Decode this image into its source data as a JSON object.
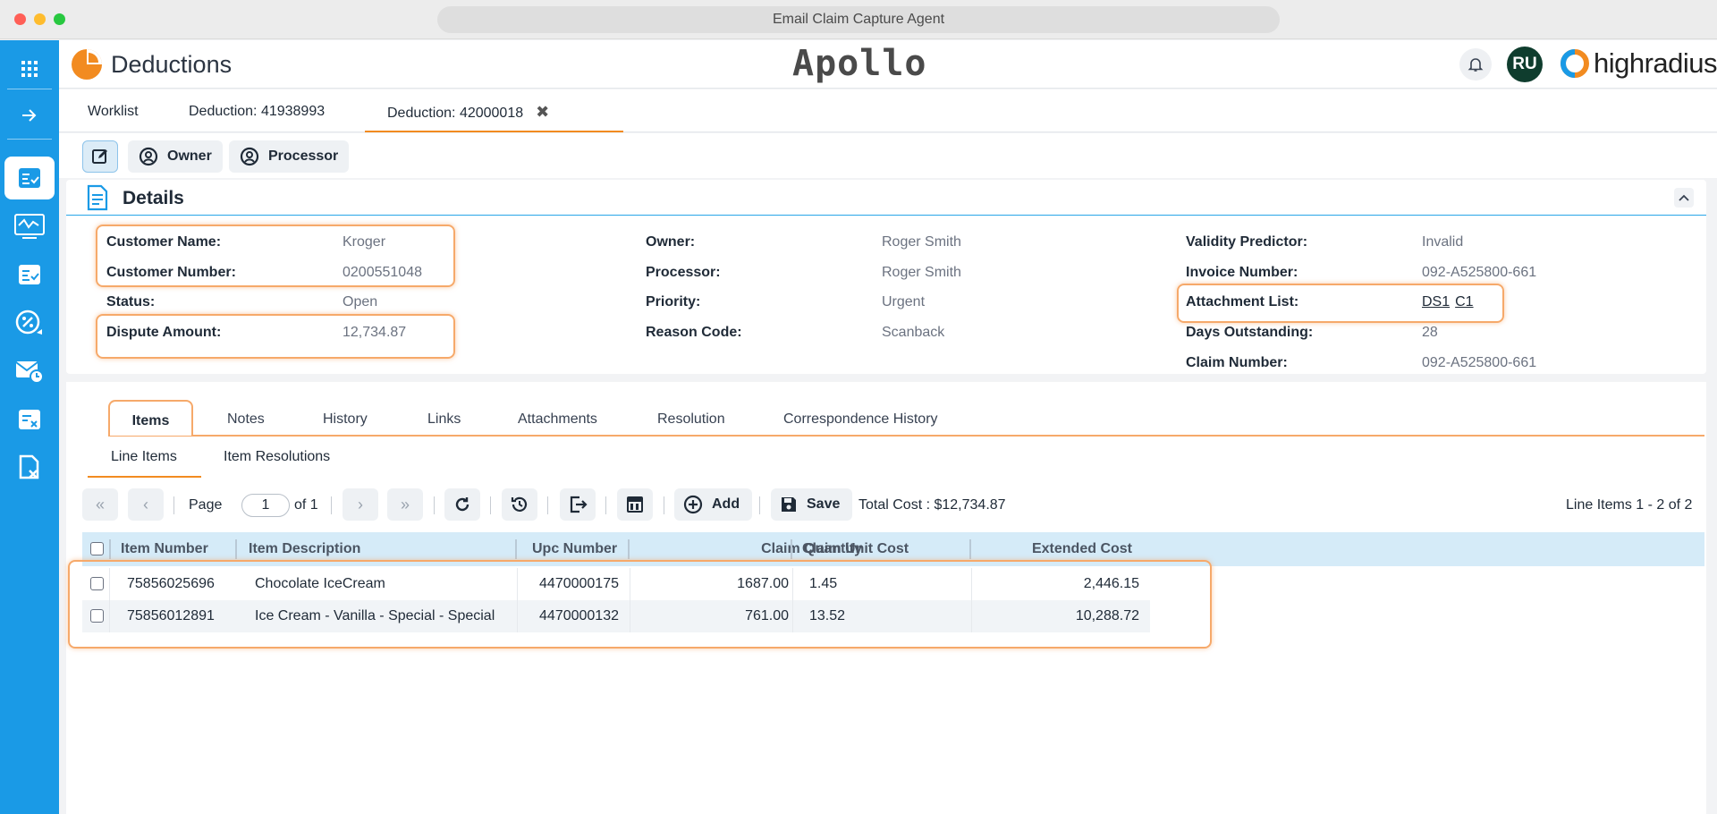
{
  "window": {
    "title": "Email Claim Capture Agent",
    "dot_colors": [
      "#ff5f57",
      "#febc2e",
      "#28c840"
    ]
  },
  "rail": {
    "icons": [
      "apps-grid-icon",
      "arrow-right-icon",
      "checklist-icon",
      "monitor-transfer-icon",
      "task-list-icon",
      "percent-badge-icon",
      "mail-clock-icon",
      "invoice-x-icon",
      "document-x-icon"
    ],
    "accent_color": "#1a9ae6"
  },
  "header": {
    "brand_name": "Deductions",
    "center_logo": "Apollo",
    "user_initials": "RU",
    "company_logo": "highradius"
  },
  "tabs": [
    {
      "label": "Worklist",
      "active": false
    },
    {
      "label": "Deduction: 41938993",
      "active": false
    },
    {
      "label": "Deduction: 42000018",
      "active": true,
      "closable": true
    }
  ],
  "toolbar": {
    "owner_label": "Owner",
    "processor_label": "Processor"
  },
  "details": {
    "title": "Details",
    "col1": [
      {
        "label": "Customer Name:",
        "value": "Kroger"
      },
      {
        "label": "Customer Number:",
        "value": "0200551048"
      },
      {
        "label": "Status:",
        "value": "Open"
      },
      {
        "label": "Dispute Amount:",
        "value": "12,734.87"
      }
    ],
    "col2": [
      {
        "label": "Owner:",
        "value": "Roger Smith"
      },
      {
        "label": "Processor:",
        "value": "Roger Smith"
      },
      {
        "label": "Priority:",
        "value": "Urgent"
      },
      {
        "label": "Reason Code:",
        "value": "Scanback"
      }
    ],
    "col3": [
      {
        "label": "Validity Predictor:",
        "value": "Invalid"
      },
      {
        "label": "Invoice Number:",
        "value": "092-A525800-661"
      },
      {
        "label": "Attachment List:",
        "links": [
          "DS1",
          "C1"
        ]
      },
      {
        "label": "Days Outstanding:",
        "value": "28"
      },
      {
        "label": "Claim Number:",
        "value": "092-A525800-661"
      }
    ]
  },
  "main_tabs": [
    "Items",
    "Notes",
    "History",
    "Links",
    "Attachments",
    "Resolution",
    "Correspondence History"
  ],
  "sub_tabs": [
    "Line Items",
    "Item Resolutions"
  ],
  "pager": {
    "page_label": "Page",
    "page_value": "1",
    "of_label": "of 1",
    "add_label": "Add",
    "save_label": "Save",
    "total_cost": "Total Cost : $12,734.87",
    "range_text": "Line Items 1 - 2 of 2"
  },
  "table": {
    "columns": [
      "Item Number",
      "Item Description",
      "Upc Number",
      "Claim Quantity",
      "Claim Unit Cost",
      "Extended Cost"
    ],
    "rows": [
      [
        "75856025696",
        "Chocolate IceCream",
        "4470000175",
        "1687.00",
        "1.45",
        "2,446.15"
      ],
      [
        "75856012891",
        "Ice Cream - Vanilla - Special - Special",
        "4470000132",
        "761.00",
        "13.52",
        "10,288.72"
      ]
    ]
  },
  "highlight_color": "#f6a96a"
}
